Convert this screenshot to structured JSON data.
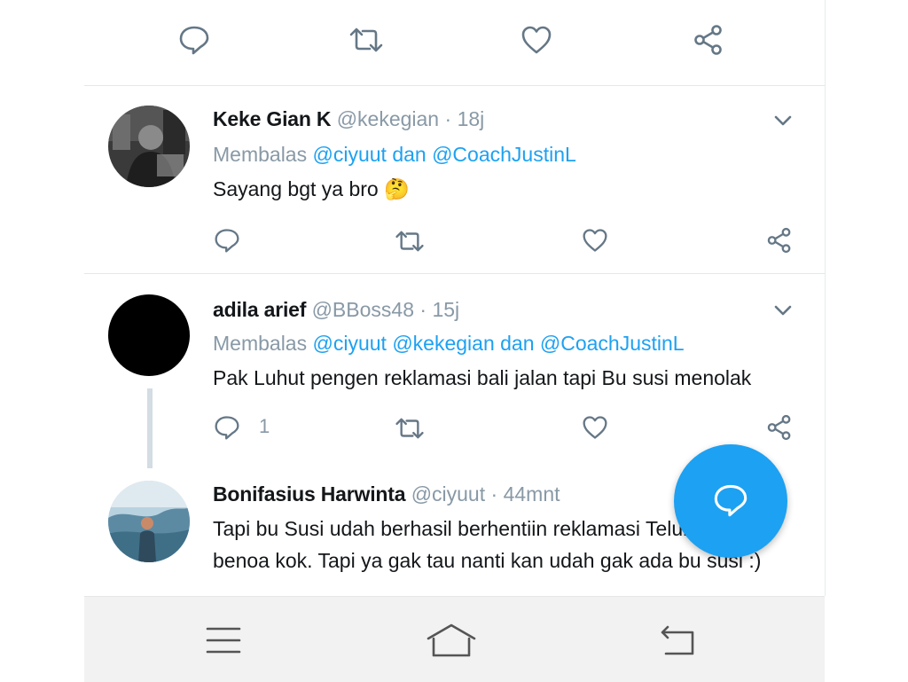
{
  "colors": {
    "accent": "#1da1f2",
    "text_primary": "#14171a",
    "text_secondary": "#8899a6",
    "icon": "#657786",
    "divider": "#e1e8ed",
    "navbar_bg": "#f2f2f2"
  },
  "top_actions": {
    "icons": [
      "reply-icon",
      "retweet-icon",
      "like-icon",
      "share-icon"
    ]
  },
  "tweets": [
    {
      "name": "Keke Gian K",
      "handle": "@kekegian",
      "separator": "·",
      "time": "18j",
      "reply_prefix": "Membalas",
      "reply_mentions": "@ciyuut dan @CoachJustinL",
      "text": "Sayang bgt ya bro",
      "emoji": "🤔",
      "reply_count": ""
    },
    {
      "name": "adila arief",
      "handle": "@BBoss48",
      "separator": "·",
      "time": "15j",
      "reply_prefix": "Membalas",
      "reply_mentions": "@ciyuut @kekegian dan @CoachJustinL",
      "text": "Pak Luhut pengen reklamasi bali jalan tapi Bu susi menolak",
      "reply_count": "1"
    },
    {
      "name": "Bonifasius Harwinta",
      "handle": "@ciyuut",
      "separator": "·",
      "time": "44mnt",
      "text_line1": "Tapi bu Susi udah berhasil berhentiin reklamasi Teluk",
      "text_line2": "benoa kok. Tapi ya gak tau nanti kan udah gak ada bu susi :)"
    }
  ],
  "fab": {
    "icon": "compose-reply-icon"
  },
  "navbar": {
    "icons": [
      "menu-icon",
      "home-icon",
      "back-icon"
    ]
  }
}
